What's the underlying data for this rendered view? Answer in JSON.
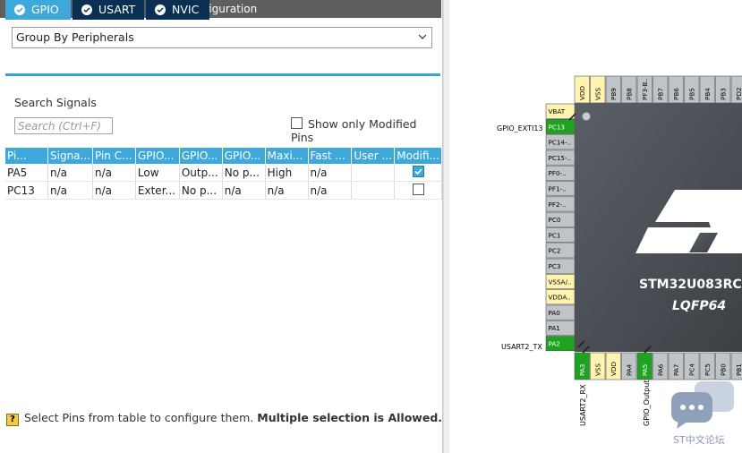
{
  "panel": {
    "title": "Configuration",
    "group_by": "Group By Peripherals",
    "tabs": [
      {
        "label": "GPIO",
        "active": true
      },
      {
        "label": "USART",
        "active": false
      },
      {
        "label": "NVIC",
        "active": false
      }
    ],
    "search_label": "Search Signals",
    "search_placeholder": "Search (Ctrl+F)",
    "show_modified_label": "Show only Modified Pins",
    "columns": [
      "Pi...",
      "Signa...",
      "Pin C...",
      "GPIO...",
      "GPIO...",
      "GPIO...",
      "Maxi...",
      "Fast ...",
      "User ...",
      "Modifi..."
    ],
    "rows": [
      {
        "cells": [
          "PA5",
          "n/a",
          "n/a",
          "Low",
          "Outp...",
          "No p...",
          "High",
          "n/a",
          ""
        ],
        "modified": true
      },
      {
        "cells": [
          "PC13",
          "n/a",
          "n/a",
          "Exter...",
          "No p...",
          "n/a",
          "n/a",
          "n/a",
          ""
        ],
        "modified": false
      }
    ],
    "footer_text": "Select Pins from table to configure them. ",
    "footer_bold": "Multiple selection is Allowed."
  },
  "chip": {
    "name": "STM32U083RC",
    "package": "LQFP64",
    "left_pins": [
      "VBAT",
      "PC13",
      "PC14-..",
      "PC15-..",
      "PF0-..",
      "PF1-..",
      "PF2-..",
      "PC0",
      "PC1",
      "PC2",
      "PC3",
      "VSSA/..",
      "VDDA..",
      "PA0",
      "PA1",
      "PA2"
    ],
    "top_pins": [
      "VDD",
      "VSS",
      "PB9",
      "PB8",
      "PF3-B..",
      "PB7",
      "PB6",
      "PB5",
      "PB4",
      "PB3",
      "PD2"
    ],
    "bottom_pins": [
      "PA3",
      "VSS",
      "VDD",
      "PA4",
      "PA5",
      "PA6",
      "PA7",
      "PC4",
      "PC5",
      "PB0",
      "PB1"
    ],
    "left_signal_labels": {
      "exti": "GPIO_EXTI13",
      "usart_tx": "USART2_TX"
    },
    "bottom_signal_labels": {
      "usart_rx": "USART2_RX",
      "gpio_out": "GPIO_Output"
    },
    "watermark": "ST中文论坛"
  },
  "colors": {
    "active_tab": "#3ea8da",
    "inactive_tab": "#0a2f52",
    "green_pin": "#1fa21f",
    "power_pin": "#fff3b0",
    "gray_pin": "#bfc4c8"
  }
}
